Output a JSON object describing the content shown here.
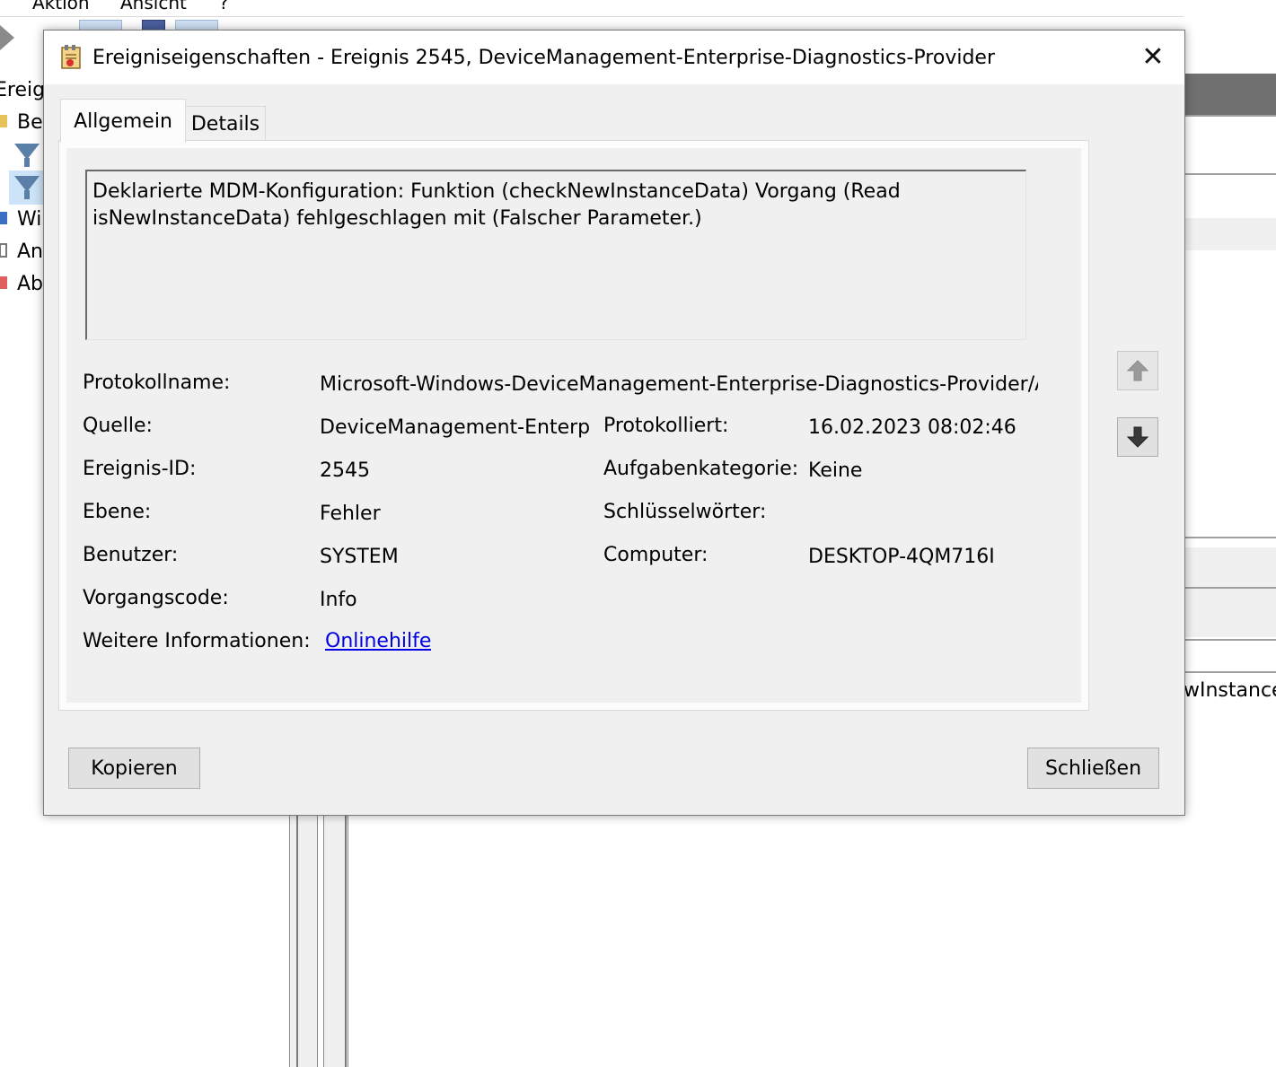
{
  "background": {
    "menu": [
      "Aktion",
      "Ansicht",
      "?"
    ],
    "tree_items": [
      "Ereign",
      "Be",
      "Wi",
      "An",
      "Ab"
    ],
    "right_pane_fragment": "wInstanceI"
  },
  "dialog": {
    "title": "Ereigniseigenschaften - Ereignis 2545, DeviceManagement-Enterprise-Diagnostics-Provider",
    "close_glyph": "✕",
    "tabs": [
      {
        "label": "Allgemein",
        "active": true
      },
      {
        "label": "Details",
        "active": false
      }
    ],
    "description": "Deklarierte MDM-Konfiguration: Funktion (checkNewInstanceData) Vorgang (Read\nisNewInstanceData) fehlgeschlagen mit (Falscher Parameter.)",
    "fields": {
      "protokollname": {
        "label": "Protokollname:",
        "value": "Microsoft-Windows-DeviceManagement-Enterprise-Diagnostics-Provider/Ad"
      },
      "quelle": {
        "label": "Quelle:",
        "value": "DeviceManagement-Enterpri"
      },
      "protokolliert": {
        "label": "Protokolliert:",
        "value": "16.02.2023 08:02:46"
      },
      "ereignis_id": {
        "label": "Ereignis-ID:",
        "value": "2545"
      },
      "aufgabenkategorie": {
        "label": "Aufgabenkategorie:",
        "value": "Keine"
      },
      "ebene": {
        "label": "Ebene:",
        "value": "Fehler"
      },
      "schluesselwoerter": {
        "label": "Schlüsselwörter:",
        "value": ""
      },
      "benutzer": {
        "label": "Benutzer:",
        "value": "SYSTEM"
      },
      "computer": {
        "label": "Computer:",
        "value": "DESKTOP-4QM716I"
      },
      "vorgangscode": {
        "label": "Vorgangscode:",
        "value": "Info"
      },
      "weitere_informationen": {
        "label": "Weitere Informationen:",
        "value": "Onlinehilfe"
      }
    },
    "nav": {
      "up_icon": "arrow-up-icon",
      "down_icon": "arrow-down-icon"
    },
    "buttons": {
      "copy": "Kopieren",
      "close": "Schließen"
    }
  },
  "colors": {
    "link": "#0000e6",
    "dialog_bg": "#f0f0f0",
    "button_bg": "#e1e1e1"
  }
}
